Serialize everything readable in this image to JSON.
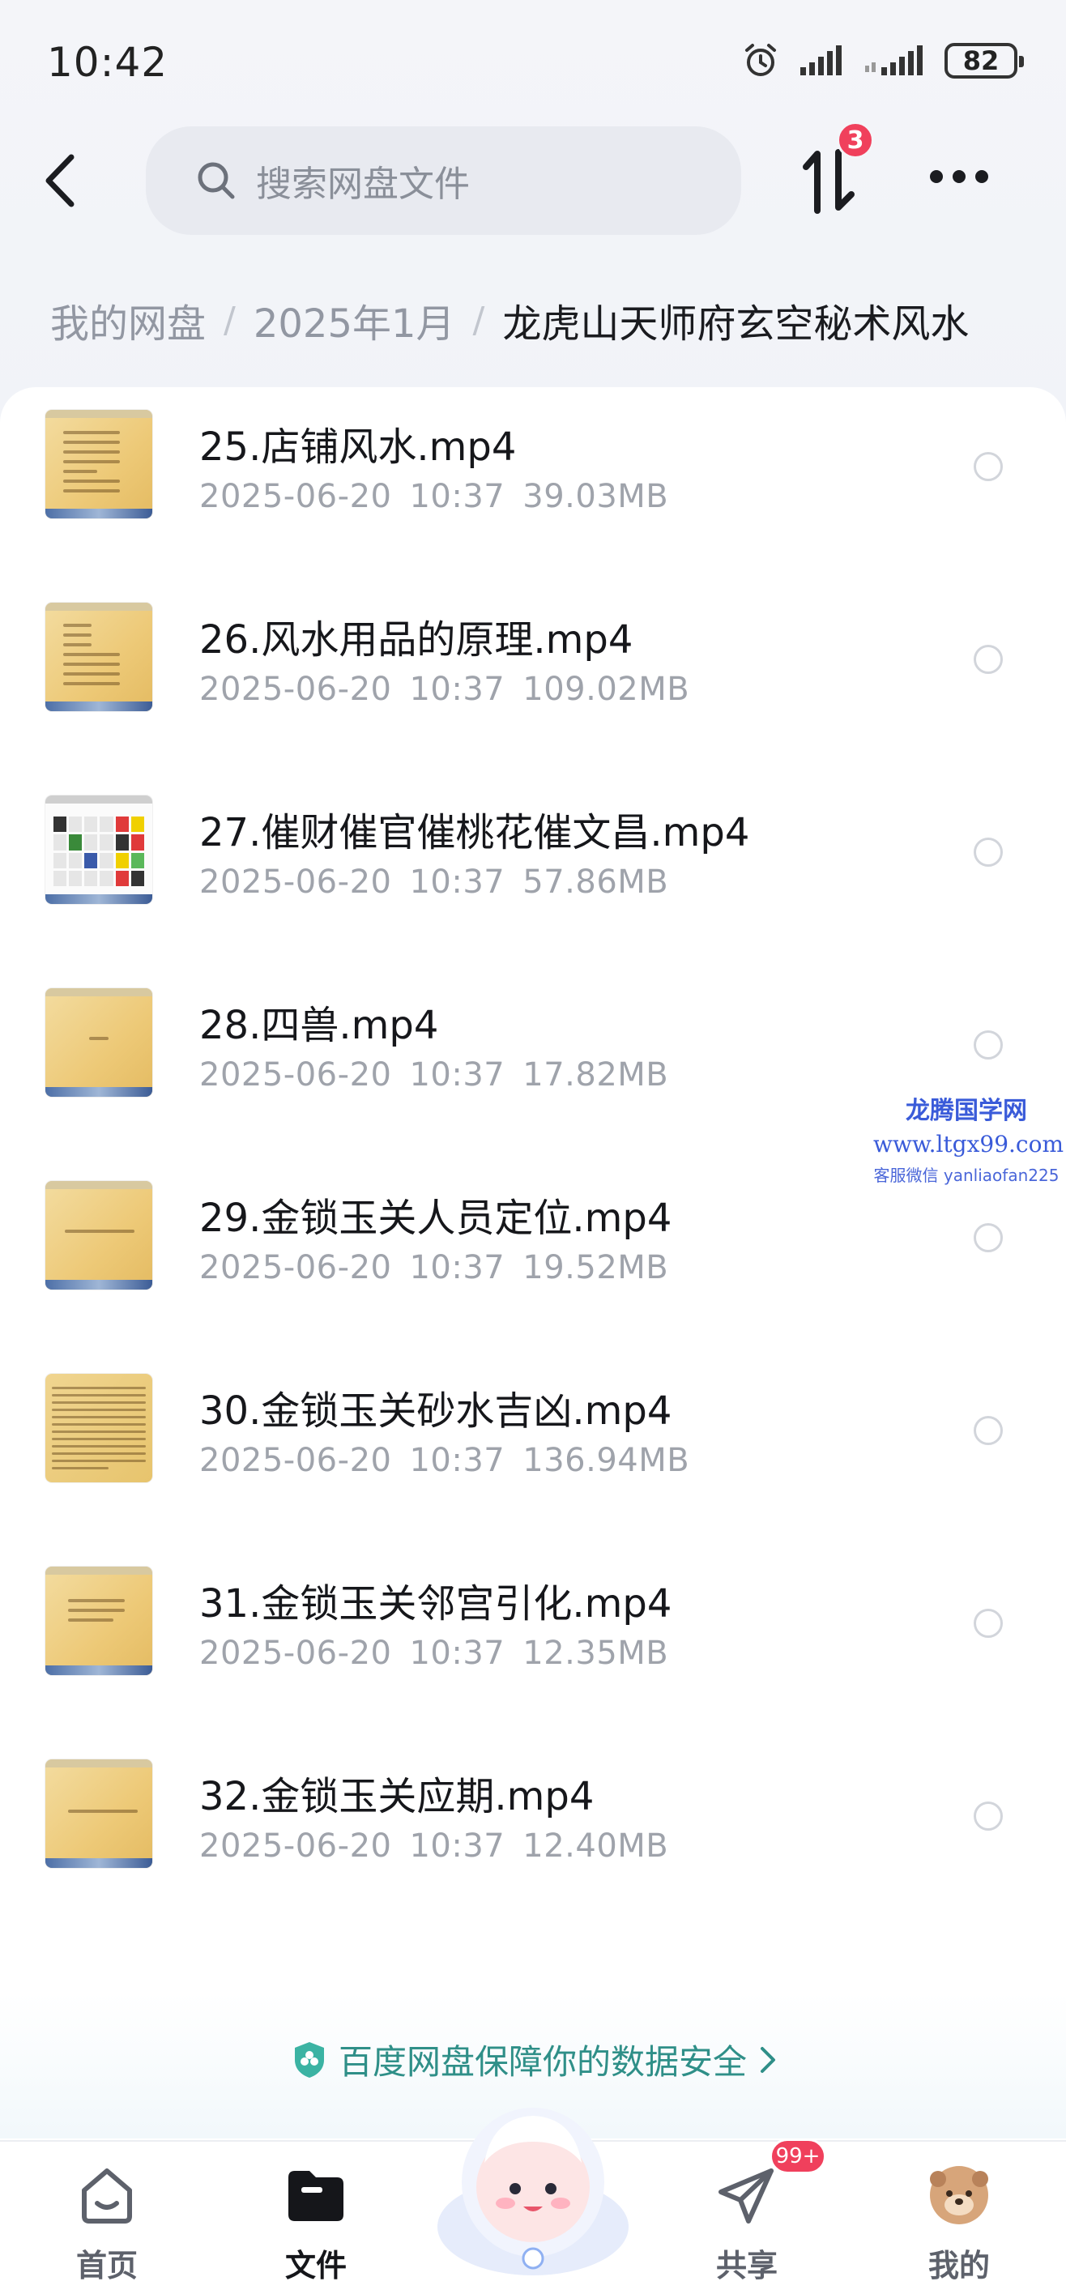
{
  "status_bar": {
    "time": "10:42",
    "battery": "82",
    "icons": [
      "alarm-icon",
      "signal-icon",
      "signal-icon",
      "battery-icon"
    ]
  },
  "header": {
    "search_placeholder": "搜索网盘文件",
    "transfer_badge": "3"
  },
  "breadcrumb": {
    "items": [
      "我的网盘",
      "2025年1月",
      "龙虎山天师府玄空秘术风水"
    ]
  },
  "files": [
    {
      "name": "25.店铺风水.mp4",
      "date": "2025-06-20",
      "time": "10:37",
      "size": "39.03MB"
    },
    {
      "name": "26.风水用品的原理.mp4",
      "date": "2025-06-20",
      "time": "10:37",
      "size": "109.02MB"
    },
    {
      "name": "27.催财催官催桃花催文昌.mp4",
      "date": "2025-06-20",
      "time": "10:37",
      "size": "57.86MB"
    },
    {
      "name": "28.四兽.mp4",
      "date": "2025-06-20",
      "time": "10:37",
      "size": "17.82MB"
    },
    {
      "name": "29.金锁玉关人员定位.mp4",
      "date": "2025-06-20",
      "time": "10:37",
      "size": "19.52MB"
    },
    {
      "name": "30.金锁玉关砂水吉凶.mp4",
      "date": "2025-06-20",
      "time": "10:37",
      "size": "136.94MB"
    },
    {
      "name": "31.金锁玉关邻宫引化.mp4",
      "date": "2025-06-20",
      "time": "10:37",
      "size": "12.35MB"
    },
    {
      "name": "32.金锁玉关应期.mp4",
      "date": "2025-06-20",
      "time": "10:37",
      "size": "12.40MB"
    }
  ],
  "watermark": {
    "title": "龙腾国学网",
    "url": "www.ltgx99.com",
    "contact": "客服微信 yanliaofan225"
  },
  "security": {
    "text": "百度网盘保障你的数据安全"
  },
  "bottom_nav": {
    "home": "首页",
    "files": "文件",
    "share": "共享",
    "share_badge": "99+",
    "mine": "我的"
  },
  "colors": {
    "accent_badge": "#f0405c",
    "security_text": "#2f8f88",
    "watermark": "#3a5bd9"
  }
}
